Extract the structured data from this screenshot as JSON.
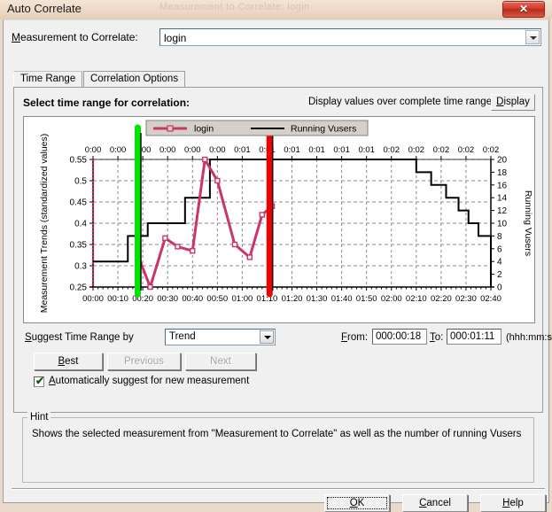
{
  "window": {
    "title": "Auto Correlate",
    "ghost_title": "Measurement to Correlate: login",
    "close_label": "✕"
  },
  "measurement": {
    "label": "Measurement to Correlate:",
    "label_prefix": "M",
    "value": "login",
    "dropdown_icon": "chevron-down-icon"
  },
  "tabs": [
    {
      "label": "Time Range",
      "selected": true
    },
    {
      "label": "Correlation Options",
      "selected": false
    }
  ],
  "panel": {
    "select_range_label": "Select time range for correlation:",
    "display_note": "Display values over complete time range",
    "display_button": "Display"
  },
  "suggest": {
    "label": "Suggest Time Range by",
    "trend_value": "Trend",
    "from_label": "From:",
    "from_value": "000:00:18",
    "to_label": "To:",
    "to_value": "000:01:11",
    "format_label": "(hhh:mm:ss)"
  },
  "buttons": {
    "best": "Best",
    "previous": "Previous",
    "next": "Next",
    "ok": "OK",
    "cancel": "Cancel",
    "help": "Help"
  },
  "auto_suggest": {
    "label": "Automatically suggest for new measurement",
    "checked": true,
    "check_glyph": "✔"
  },
  "hint": {
    "legend": "Hint",
    "text": "Shows the selected measurement from \"Measurement to Correlate\" as well as the number of running Vusers"
  },
  "chart_data": {
    "type": "line",
    "title": "",
    "legend_position": "top-center",
    "grid": true,
    "ylabel": "Measurement Trends (standardized values)",
    "ylabel_right": "Running Vusers",
    "xlabel": "",
    "ylim": [
      0.25,
      0.55
    ],
    "yticks": [
      0.25,
      0.3,
      0.35,
      0.4,
      0.45,
      0.5,
      0.55
    ],
    "ytick_labels": [
      "0.25",
      "0.3",
      "0.35",
      "0.4",
      "0.45",
      "0.5",
      "0.55"
    ],
    "ylim_right": [
      0,
      20
    ],
    "yticks_right": [
      0,
      2,
      4,
      6,
      8,
      10,
      12,
      14,
      16,
      18,
      20
    ],
    "ytick_labels_right": [
      "0",
      "2",
      "4",
      "6",
      "8",
      "10",
      "12",
      "14",
      "16",
      "18",
      "20"
    ],
    "xlim": [
      0,
      160
    ],
    "xticks": [
      0,
      10,
      20,
      30,
      40,
      50,
      60,
      70,
      80,
      90,
      100,
      110,
      120,
      130,
      140,
      150,
      160
    ],
    "xtick_labels": [
      "00:00",
      "00:10",
      "00:20",
      "00:30",
      "00:40",
      "00:50",
      "01:00",
      "01:10",
      "01:20",
      "01:30",
      "01:40",
      "01:50",
      "02:00",
      "02:10",
      "02:20",
      "02:30",
      "02:40"
    ],
    "xtick_labels_top": [
      "0:00",
      "0:00",
      "0:00",
      "0:00",
      "0:00",
      "0:00",
      "0:01",
      "0:01",
      "0:01",
      "0:01",
      "0:01",
      "0:01",
      "0:02",
      "0:02",
      "0:02",
      "0:02",
      "0:02"
    ],
    "series": [
      {
        "name": "login",
        "color": "#cc3366",
        "axis": "left",
        "marker": "square",
        "x": [
          18,
          23,
          29,
          34,
          40,
          45,
          50,
          57,
          63,
          68,
          72
        ],
        "values": [
          0.325,
          0.25,
          0.365,
          0.345,
          0.335,
          0.55,
          0.5,
          0.35,
          0.32,
          0.42,
          0.44
        ]
      },
      {
        "name": "Running Vusers",
        "color": "#000000",
        "axis": "right",
        "step": true,
        "x": [
          0,
          14,
          22,
          37,
          47,
          122,
          130,
          136,
          142,
          147,
          151,
          155,
          160
        ],
        "values": [
          4,
          8,
          10,
          14,
          20,
          20,
          18,
          16,
          14,
          12,
          10,
          8,
          6
        ]
      }
    ],
    "markers": [
      {
        "name": "range-start",
        "x": 18,
        "color": "#00e500"
      },
      {
        "name": "range-end",
        "x": 71,
        "color": "#ee0000"
      }
    ]
  }
}
